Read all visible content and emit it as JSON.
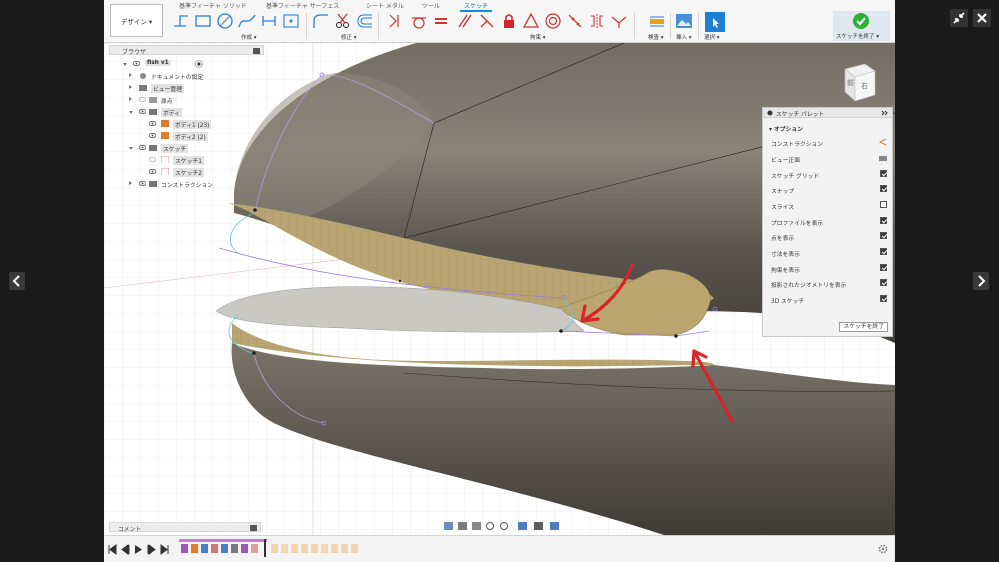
{
  "ribbon": {
    "design_label": "デザイン ▾",
    "tabs": [
      "基準フィーチャ ソリッド",
      "基準フィーチャ サーフェス",
      "シート メタル",
      "ツール",
      "スケッチ"
    ],
    "groups": {
      "create": "作成 ▾",
      "modify": "修正 ▾",
      "constraints": "拘束 ▾",
      "inspect": "検査 ▾",
      "insert": "挿入 ▾",
      "select": "選択 ▾",
      "finish": "スケッチを終了 ▾"
    }
  },
  "browser": {
    "title": "ブラウザ",
    "items": [
      {
        "label": "fish v1"
      },
      {
        "label": "ドキュメントの設定"
      },
      {
        "label": "ビュー管理"
      },
      {
        "label": "原点"
      },
      {
        "label": "ボディ"
      },
      {
        "label": "ボディ1 (23)"
      },
      {
        "label": "ボディ2 (2)"
      },
      {
        "label": "スケッチ"
      },
      {
        "label": "スケッチ1"
      },
      {
        "label": "スケッチ2"
      },
      {
        "label": "コンストラクション"
      }
    ]
  },
  "viewcube": {
    "front": "前",
    "right": "右"
  },
  "palette": {
    "title": "スケッチ パレット",
    "section": "オプション",
    "rows": [
      {
        "label": "コンストラクション",
        "checked": false
      },
      {
        "label": "ビュー正面",
        "checked": false
      },
      {
        "label": "スケッチ グリッド",
        "checked": true
      },
      {
        "label": "スナップ",
        "checked": true
      },
      {
        "label": "スライス",
        "checked": false
      },
      {
        "label": "プロファイルを表示",
        "checked": true
      },
      {
        "label": "点を表示",
        "checked": true
      },
      {
        "label": "寸法を表示",
        "checked": true
      },
      {
        "label": "拘束を表示",
        "checked": true
      },
      {
        "label": "投影されたジオメトリを表示",
        "checked": true
      },
      {
        "label": "3D スケッチ",
        "checked": true
      }
    ],
    "finish_button": "スケッチを終了"
  },
  "comment": {
    "label": "コメント"
  },
  "colors": {
    "accent": "#0b8fd4",
    "finish_green": "#2fae3a",
    "body_dark": "#5a5650",
    "surface_tan": "#b8a36f",
    "sketch_purple": "#9b7fd1",
    "annotation_red": "#d9232a"
  }
}
